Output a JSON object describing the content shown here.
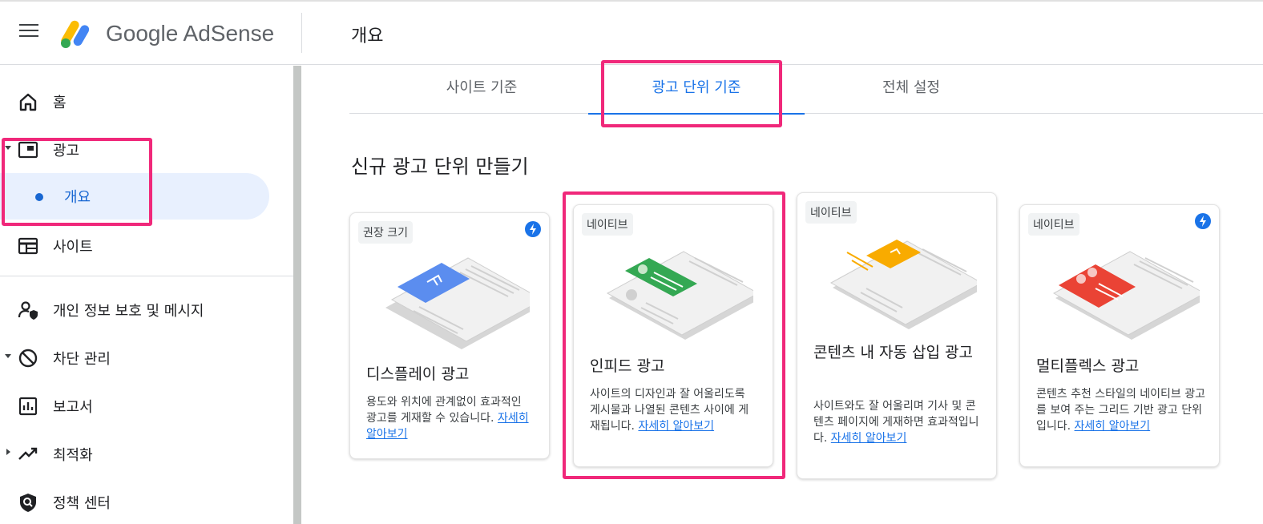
{
  "header": {
    "brand": "Google AdSense",
    "page_title": "개요"
  },
  "sidebar": {
    "items": [
      {
        "label": "홈",
        "icon": "home-icon"
      },
      {
        "label": "광고",
        "icon": "ads-icon"
      },
      {
        "label": "개요"
      },
      {
        "label": "사이트",
        "icon": "sites-icon"
      },
      {
        "label": "개인 정보 보호 및 메시지",
        "icon": "privacy-icon"
      },
      {
        "label": "차단 관리",
        "icon": "block-icon"
      },
      {
        "label": "보고서",
        "icon": "reports-icon"
      },
      {
        "label": "최적화",
        "icon": "optimize-icon"
      },
      {
        "label": "정책 센터",
        "icon": "policy-icon"
      }
    ]
  },
  "tabs": [
    {
      "label": "사이트 기준"
    },
    {
      "label": "광고 단위 기준"
    },
    {
      "label": "전체 설정"
    }
  ],
  "section_title": "신규 광고 단위 만들기",
  "cards": [
    {
      "badge": "권장 크기",
      "title": "디스플레이 광고",
      "desc": "용도와 위치에 관계없이 효과적인 광고를 게재할 수 있습니다.",
      "link": "자세히 알아보기"
    },
    {
      "badge": "네이티브",
      "title": "인피드 광고",
      "desc": "사이트의 디자인과 잘 어울리도록 게시물과 나열된 콘텐츠 사이에 게재됩니다.",
      "link": "자세히 알아보기"
    },
    {
      "badge": "네이티브",
      "title": "콘텐츠 내 자동 삽입 광고",
      "desc": "사이트와도 잘 어울리며 기사 및 콘텐츠 페이지에 게재하면 효과적입니다.",
      "link": "자세히 알아보기"
    },
    {
      "badge": "네이티브",
      "title": "멀티플렉스 광고",
      "desc": "콘텐츠 추천 스타일의 네이티브 광고를 보여 주는 그리드 기반 광고 단위입니다.",
      "link": "자세히 알아보기"
    }
  ],
  "colors": {
    "accent": "#1a73e8",
    "highlight": "#f0287a",
    "display_ad": "#5b8def",
    "infeed_ad": "#34a853",
    "inarticle_ad": "#f9ab00",
    "multiplex_ad": "#ea4335"
  }
}
